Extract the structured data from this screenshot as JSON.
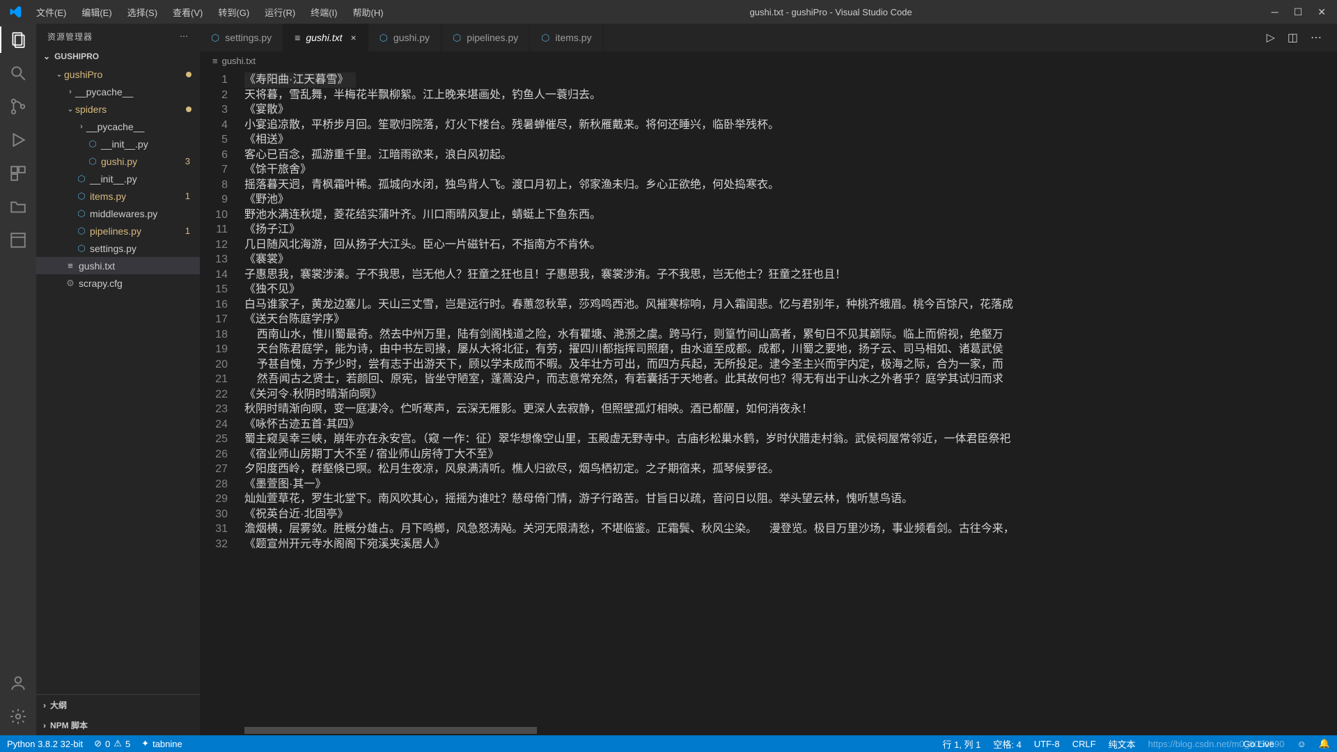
{
  "titlebar": {
    "menus": [
      "文件(E)",
      "编辑(E)",
      "选择(S)",
      "查看(V)",
      "转到(G)",
      "运行(R)",
      "终端(I)",
      "帮助(H)"
    ],
    "title": "gushi.txt - gushiPro - Visual Studio Code"
  },
  "sidebar": {
    "header": "资源管理器",
    "project": "GUSHIPRO",
    "tree": [
      {
        "ind": 1,
        "chev": "v",
        "label": "gushiPro",
        "mod": true,
        "dot": true,
        "folder": true
      },
      {
        "ind": 2,
        "chev": ">",
        "label": "__pycache__",
        "folder": true
      },
      {
        "ind": 2,
        "chev": "v",
        "label": "spiders",
        "mod": true,
        "dot": true,
        "folder": true
      },
      {
        "ind": 3,
        "chev": ">",
        "label": "__pycache__",
        "folder": true
      },
      {
        "ind": 3,
        "ico": "py",
        "label": "__init__.py"
      },
      {
        "ind": 3,
        "ico": "py",
        "label": "gushi.py",
        "mod": true,
        "badge": "3"
      },
      {
        "ind": 2,
        "ico": "py",
        "label": "__init__.py"
      },
      {
        "ind": 2,
        "ico": "py",
        "label": "items.py",
        "mod": true,
        "badge": "1"
      },
      {
        "ind": 2,
        "ico": "py",
        "label": "middlewares.py"
      },
      {
        "ind": 2,
        "ico": "py",
        "label": "pipelines.py",
        "mod": true,
        "badge": "1"
      },
      {
        "ind": 2,
        "ico": "py",
        "label": "settings.py"
      },
      {
        "ind": 1,
        "ico": "txt",
        "label": "gushi.txt",
        "sel": true
      },
      {
        "ind": 1,
        "ico": "cfg",
        "label": "scrapy.cfg"
      }
    ],
    "outline": "大纲",
    "npm": "NPM 脚本"
  },
  "tabs": [
    {
      "ico": "py",
      "label": "settings.py"
    },
    {
      "ico": "txt",
      "label": "gushi.txt",
      "active": true,
      "close": true
    },
    {
      "ico": "py",
      "label": "gushi.py"
    },
    {
      "ico": "py",
      "label": "pipelines.py"
    },
    {
      "ico": "py",
      "label": "items.py"
    }
  ],
  "breadcrumb": {
    "ico": "≡",
    "file": "gushi.txt"
  },
  "code": [
    "《寿阳曲·江天暮雪》",
    "天将暮，雪乱舞，半梅花半飘柳絮。江上晚来堪画处，钓鱼人一蓑归去。",
    "《宴散》",
    "小宴追凉散，平桥步月回。笙歌归院落，灯火下楼台。残暑蝉催尽，新秋雁戴来。将何还睡兴，临卧举残杯。",
    "《相送》",
    "客心已百念，孤游重千里。江暗雨欲来，浪白风初起。",
    "《馀干旅舍》",
    "摇落暮天迥，青枫霜叶稀。孤城向水闭，独鸟背人飞。渡口月初上，邻家渔未归。乡心正欲绝，何处捣寒衣。",
    "《野池》",
    "野池水满连秋堤，菱花结实蒲叶齐。川口雨晴风复止，蜻蜓上下鱼东西。",
    "《扬子江》",
    "几日随风北海游，回从扬子大江头。臣心一片磁针石，不指南方不肯休。",
    "《褰裳》",
    "子惠思我，褰裳涉溱。子不我思，岂无他人？狂童之狂也且！子惠思我，褰裳涉洧。子不我思，岂无他士？狂童之狂也且！",
    "《独不见》",
    "白马谁家子，黄龙边塞儿。天山三丈雪，岂是远行时。春蕙忽秋草，莎鸡鸣西池。风摧寒棕响，月入霜闺悲。忆与君别年，种桃齐蛾眉。桃今百馀尺，花落成",
    "《送天台陈庭学序》",
    "    西南山水，惟川蜀最奇。然去中州万里，陆有剑阁栈道之险，水有瞿塘、滟滪之虞。跨马行，则篁竹间山高者，累旬日不见其巅际。临上而俯视，绝壑万",
    "    天台陈君庭学，能为诗，由中书左司掾，屡从大将北征，有劳，擢四川都指挥司照磨，由水道至成都。成都，川蜀之要地，扬子云、司马相如、诸葛武侯",
    "    予甚自愧，方予少时，尝有志于出游天下，顾以学未成而不暇。及年壮方可出，而四方兵起，无所投足。逮今圣主兴而宇内定，极海之际，合为一家，而",
    "    然吾闻古之贤士，若颜回、原宪，皆坐守陋室，蓬蒿没户，而志意常充然，有若囊括于天地者。此其故何也？得无有出于山水之外者乎？庭学其试归而求",
    "《关河令·秋阴时晴渐向暝》",
    "秋阴时晴渐向暝，变一庭凄冷。伫听寒声，云深无雁影。更深人去寂静，但照壁孤灯相映。酒已都醒，如何消夜永！",
    "《咏怀古迹五首·其四》",
    "蜀主窥吴幸三峡，崩年亦在永安宫。（窥 一作：征）翠华想像空山里，玉殿虚无野寺中。古庙杉松巢水鹤，岁时伏腊走村翁。武侯祠屋常邻近，一体君臣祭祀",
    "《宿业师山房期丁大不至 / 宿业师山房待丁大不至》",
    "夕阳度西岭，群壑倏已暝。松月生夜凉，风泉满清听。樵人归欲尽，烟鸟栖初定。之子期宿来，孤琴候萝径。",
    "《墨萱图·其一》",
    "灿灿萱草花，罗生北堂下。南风吹其心，摇摇为谁吐？慈母倚门情，游子行路苦。甘旨日以疏，音问日以阻。举头望云林，愧听慧鸟语。",
    "《祝英台近·北固亭》",
    "澹烟横，层雾敛。胜概分雄占。月下鸣榔，风急怒涛飐。关河无限清愁，不堪临鉴。正霜鬓、秋风尘染。    漫登览。极目万里沙场，事业频看剑。古往今来，",
    "《题宣州开元寺水阁阁下宛溪夹溪居人》"
  ],
  "status": {
    "left": {
      "python": "Python 3.8.2 32-bit",
      "errs": "0",
      "warns": "5",
      "tabnine": "tabnine"
    },
    "right": {
      "pos": "行 1, 列 1",
      "spaces": "空格: 4",
      "enc": "UTF-8",
      "eol": "CRLF",
      "lang": "纯文本",
      "golive": "Go Live",
      "watermark": "https://blog.csdn.net/m0_5050590"
    }
  }
}
